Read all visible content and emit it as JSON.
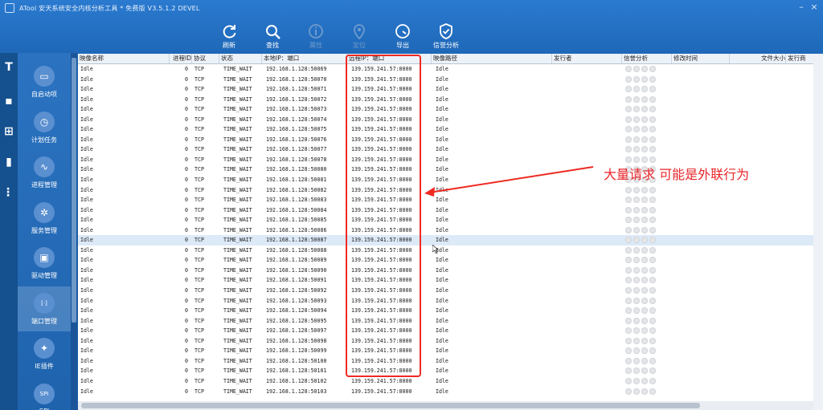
{
  "window": {
    "title": "ATool 安天系统安全内核分析工具 * 免费版 V3.5.1.2 DEVEL"
  },
  "toolbar": [
    {
      "label": "刷新",
      "icon": "refresh-icon",
      "enabled": true
    },
    {
      "label": "查找",
      "icon": "search-icon",
      "enabled": true
    },
    {
      "label": "属性",
      "icon": "info-icon",
      "enabled": false
    },
    {
      "label": "定位",
      "icon": "locate-icon",
      "enabled": false
    },
    {
      "label": "导出",
      "icon": "export-icon",
      "enabled": true
    },
    {
      "label": "信誉分析",
      "icon": "shield-icon",
      "enabled": true
    }
  ],
  "nav": [
    {
      "label": "自启动项",
      "icon": "monitor-icon"
    },
    {
      "label": "计划任务",
      "icon": "clock-icon"
    },
    {
      "label": "进程管理",
      "icon": "process-icon"
    },
    {
      "label": "服务管理",
      "icon": "gear-icon"
    },
    {
      "label": "驱动管理",
      "icon": "driver-icon"
    },
    {
      "label": "端口管理",
      "icon": "port-icon"
    },
    {
      "label": "IE插件",
      "icon": "ie-plugin-icon"
    },
    {
      "label": "SPI",
      "icon": "spi-icon"
    }
  ],
  "active_nav": "端口管理",
  "columns": [
    "映像名称",
    "进程ID",
    "协议",
    "状态",
    "本地IP：端口",
    "远程IP：端口",
    "映像路径",
    "发行者",
    "信誉分析",
    "修改时间",
    "文件大小",
    "发行商"
  ],
  "rows": [
    {
      "name": "Idle",
      "pid": "0",
      "proto": "TCP",
      "state": "TIME_WAIT",
      "local": "192.168.1.128:50069",
      "remote": "139.159.241.57:8000",
      "path": "Idle"
    },
    {
      "name": "Idle",
      "pid": "0",
      "proto": "TCP",
      "state": "TIME_WAIT",
      "local": "192.168.1.128:50070",
      "remote": "139.159.241.57:8000",
      "path": "Idle"
    },
    {
      "name": "Idle",
      "pid": "0",
      "proto": "TCP",
      "state": "TIME_WAIT",
      "local": "192.168.1.128:50071",
      "remote": "139.159.241.57:8000",
      "path": "Idle"
    },
    {
      "name": "Idle",
      "pid": "0",
      "proto": "TCP",
      "state": "TIME_WAIT",
      "local": "192.168.1.128:50072",
      "remote": "139.159.241.57:8000",
      "path": "Idle"
    },
    {
      "name": "Idle",
      "pid": "0",
      "proto": "TCP",
      "state": "TIME_WAIT",
      "local": "192.168.1.128:50073",
      "remote": "139.159.241.57:8000",
      "path": "Idle"
    },
    {
      "name": "Idle",
      "pid": "0",
      "proto": "TCP",
      "state": "TIME_WAIT",
      "local": "192.168.1.128:50074",
      "remote": "139.159.241.57:8000",
      "path": "Idle"
    },
    {
      "name": "Idle",
      "pid": "0",
      "proto": "TCP",
      "state": "TIME_WAIT",
      "local": "192.168.1.128:50075",
      "remote": "139.159.241.57:8000",
      "path": "Idle"
    },
    {
      "name": "Idle",
      "pid": "0",
      "proto": "TCP",
      "state": "TIME_WAIT",
      "local": "192.168.1.128:50076",
      "remote": "139.159.241.57:8000",
      "path": "Idle"
    },
    {
      "name": "Idle",
      "pid": "0",
      "proto": "TCP",
      "state": "TIME_WAIT",
      "local": "192.168.1.128:50077",
      "remote": "139.159.241.57:8000",
      "path": "Idle"
    },
    {
      "name": "Idle",
      "pid": "0",
      "proto": "TCP",
      "state": "TIME_WAIT",
      "local": "192.168.1.128:50078",
      "remote": "139.159.241.57:8000",
      "path": "Idle"
    },
    {
      "name": "Idle",
      "pid": "0",
      "proto": "TCP",
      "state": "TIME_WAIT",
      "local": "192.168.1.128:50080",
      "remote": "139.159.241.57:8000",
      "path": "Idle"
    },
    {
      "name": "Idle",
      "pid": "0",
      "proto": "TCP",
      "state": "TIME_WAIT",
      "local": "192.168.1.128:50081",
      "remote": "139.159.241.57:8000",
      "path": "Idle"
    },
    {
      "name": "Idle",
      "pid": "0",
      "proto": "TCP",
      "state": "TIME_WAIT",
      "local": "192.168.1.128:50082",
      "remote": "139.159.241.57:8000",
      "path": "Idle"
    },
    {
      "name": "Idle",
      "pid": "0",
      "proto": "TCP",
      "state": "TIME_WAIT",
      "local": "192.168.1.128:50083",
      "remote": "139.159.241.57:8000",
      "path": "Idle"
    },
    {
      "name": "Idle",
      "pid": "0",
      "proto": "TCP",
      "state": "TIME_WAIT",
      "local": "192.168.1.128:50084",
      "remote": "139.159.241.57:8000",
      "path": "Idle"
    },
    {
      "name": "Idle",
      "pid": "0",
      "proto": "TCP",
      "state": "TIME_WAIT",
      "local": "192.168.1.128:50085",
      "remote": "139.159.241.57:8000",
      "path": "Idle"
    },
    {
      "name": "Idle",
      "pid": "0",
      "proto": "TCP",
      "state": "TIME_WAIT",
      "local": "192.168.1.128:50086",
      "remote": "139.159.241.57:8000",
      "path": "Idle"
    },
    {
      "name": "Idle",
      "pid": "0",
      "proto": "TCP",
      "state": "TIME_WAIT",
      "local": "192.168.1.128:50087",
      "remote": "139.159.241.57:8000",
      "path": "Idle"
    },
    {
      "name": "Idle",
      "pid": "0",
      "proto": "TCP",
      "state": "TIME_WAIT",
      "local": "192.168.1.128:50088",
      "remote": "139.159.241.57:8000",
      "path": "Idle"
    },
    {
      "name": "Idle",
      "pid": "0",
      "proto": "TCP",
      "state": "TIME_WAIT",
      "local": "192.168.1.128:50089",
      "remote": "139.159.241.57:8000",
      "path": "Idle"
    },
    {
      "name": "Idle",
      "pid": "0",
      "proto": "TCP",
      "state": "TIME_WAIT",
      "local": "192.168.1.128:50090",
      "remote": "139.159.241.57:8000",
      "path": "Idle"
    },
    {
      "name": "Idle",
      "pid": "0",
      "proto": "TCP",
      "state": "TIME_WAIT",
      "local": "192.168.1.128:50091",
      "remote": "139.159.241.57:8000",
      "path": "Idle"
    },
    {
      "name": "Idle",
      "pid": "0",
      "proto": "TCP",
      "state": "TIME_WAIT",
      "local": "192.168.1.128:50092",
      "remote": "139.159.241.57:8000",
      "path": "Idle"
    },
    {
      "name": "Idle",
      "pid": "0",
      "proto": "TCP",
      "state": "TIME_WAIT",
      "local": "192.168.1.128:50093",
      "remote": "139.159.241.57:8000",
      "path": "Idle"
    },
    {
      "name": "Idle",
      "pid": "0",
      "proto": "TCP",
      "state": "TIME_WAIT",
      "local": "192.168.1.128:50094",
      "remote": "139.159.241.57:8000",
      "path": "Idle"
    },
    {
      "name": "Idle",
      "pid": "0",
      "proto": "TCP",
      "state": "TIME_WAIT",
      "local": "192.168.1.128:50095",
      "remote": "139.159.241.57:8000",
      "path": "Idle"
    },
    {
      "name": "Idle",
      "pid": "0",
      "proto": "TCP",
      "state": "TIME_WAIT",
      "local": "192.168.1.128:50097",
      "remote": "139.159.241.57:8000",
      "path": "Idle"
    },
    {
      "name": "Idle",
      "pid": "0",
      "proto": "TCP",
      "state": "TIME_WAIT",
      "local": "192.168.1.128:50098",
      "remote": "139.159.241.57:8000",
      "path": "Idle"
    },
    {
      "name": "Idle",
      "pid": "0",
      "proto": "TCP",
      "state": "TIME_WAIT",
      "local": "192.168.1.128:50099",
      "remote": "139.159.241.57:8000",
      "path": "Idle"
    },
    {
      "name": "Idle",
      "pid": "0",
      "proto": "TCP",
      "state": "TIME_WAIT",
      "local": "192.168.1.128:50100",
      "remote": "139.159.241.57:8000",
      "path": "Idle"
    },
    {
      "name": "Idle",
      "pid": "0",
      "proto": "TCP",
      "state": "TIME_WAIT",
      "local": "192.168.1.128:50101",
      "remote": "139.159.241.57:8000",
      "path": "Idle"
    },
    {
      "name": "Idle",
      "pid": "0",
      "proto": "TCP",
      "state": "TIME_WAIT",
      "local": "192.168.1.128:50102",
      "remote": "139.159.241.57:8000",
      "path": "Idle"
    },
    {
      "name": "Idle",
      "pid": "0",
      "proto": "TCP",
      "state": "TIME_WAIT",
      "local": "192.168.1.128:50103",
      "remote": "139.159.241.57:8000",
      "path": "Idle"
    }
  ],
  "selected_row_local": "192.168.1.128:50087",
  "annotation": {
    "text": "大量请求 可能是外联行为",
    "color": "#e8262a"
  },
  "colors": {
    "accent": "#1f68b8",
    "annotation_red": "#ee2a23",
    "selected_row": "#dce9f7"
  }
}
